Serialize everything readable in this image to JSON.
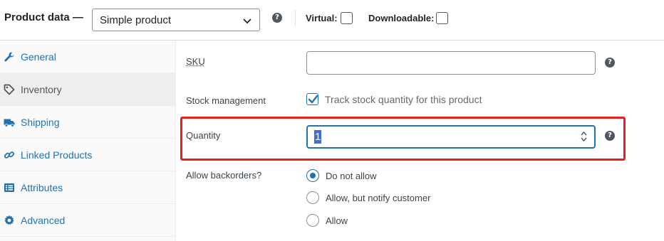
{
  "header": {
    "title": "Product data —",
    "product_type": "Simple product",
    "virtual_label": "Virtual:",
    "downloadable_label": "Downloadable:",
    "help_glyph": "?"
  },
  "sidebar": {
    "items": [
      {
        "label": "General",
        "icon": "wrench-icon",
        "active": false
      },
      {
        "label": "Inventory",
        "icon": "tag-icon",
        "active": true
      },
      {
        "label": "Shipping",
        "icon": "truck-icon",
        "active": false
      },
      {
        "label": "Linked Products",
        "icon": "link-icon",
        "active": false
      },
      {
        "label": "Attributes",
        "icon": "list-icon",
        "active": false
      },
      {
        "label": "Advanced",
        "icon": "gear-icon",
        "active": false
      }
    ]
  },
  "form": {
    "sku_label": "SKU",
    "sku_value": "",
    "stock_label": "Stock management",
    "track_label": "Track stock quantity for this product",
    "track_checked": true,
    "quantity_label": "Quantity",
    "quantity_value": "1",
    "backorders_label": "Allow backorders?",
    "backorder_options": [
      "Do not allow",
      "Allow, but notify customer",
      "Allow"
    ],
    "backorder_selected": "Do not allow"
  },
  "colors": {
    "accent": "#2271b1",
    "highlight_border": "#e8201c",
    "selection": "#3a6fd8"
  }
}
